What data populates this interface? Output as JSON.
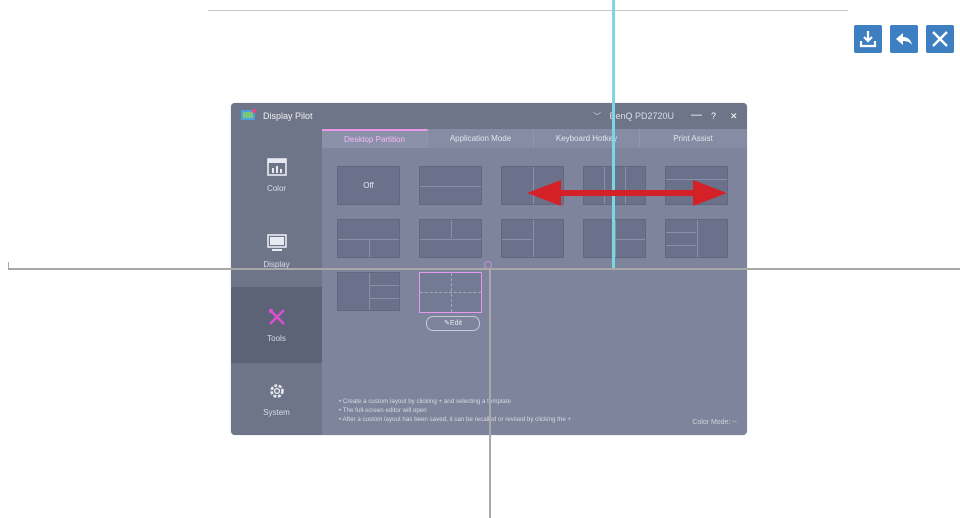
{
  "toolbar": {
    "icons": [
      "download-icon",
      "undo-icon",
      "close-icon"
    ],
    "accent": "#3e7fc1"
  },
  "window": {
    "app_title": "Display Pilot",
    "monitor": "BenQ PD2720U",
    "controls": {
      "minimize": "—",
      "help": "?",
      "close": "✕"
    }
  },
  "sidebar": {
    "items": [
      {
        "label": "Color",
        "icon": "color-chart-icon"
      },
      {
        "label": "Display",
        "icon": "monitor-icon"
      },
      {
        "label": "Tools",
        "icon": "tools-icon",
        "active": true
      },
      {
        "label": "System",
        "icon": "gear-icon"
      }
    ]
  },
  "tabs": [
    {
      "label": "Desktop Partition",
      "active": true
    },
    {
      "label": "Application Mode"
    },
    {
      "label": "Keyboard Hotkey"
    },
    {
      "label": "Print Assist"
    }
  ],
  "partition": {
    "off_label": "Off",
    "edit_label": "✎Edit"
  },
  "help": {
    "lines": [
      "•  Create a custom layout by clicking + and selecting a template",
      "•  The full-screen editor will open",
      "•  After a custom layout has been saved, it can be recalled or revised by clicking the +"
    ]
  },
  "status": {
    "color_mode": "Color Mode: --"
  },
  "colors": {
    "active_tab": "#e99ae9",
    "arrow": "#d42127",
    "guide_cyan": "#7ed6e2"
  }
}
